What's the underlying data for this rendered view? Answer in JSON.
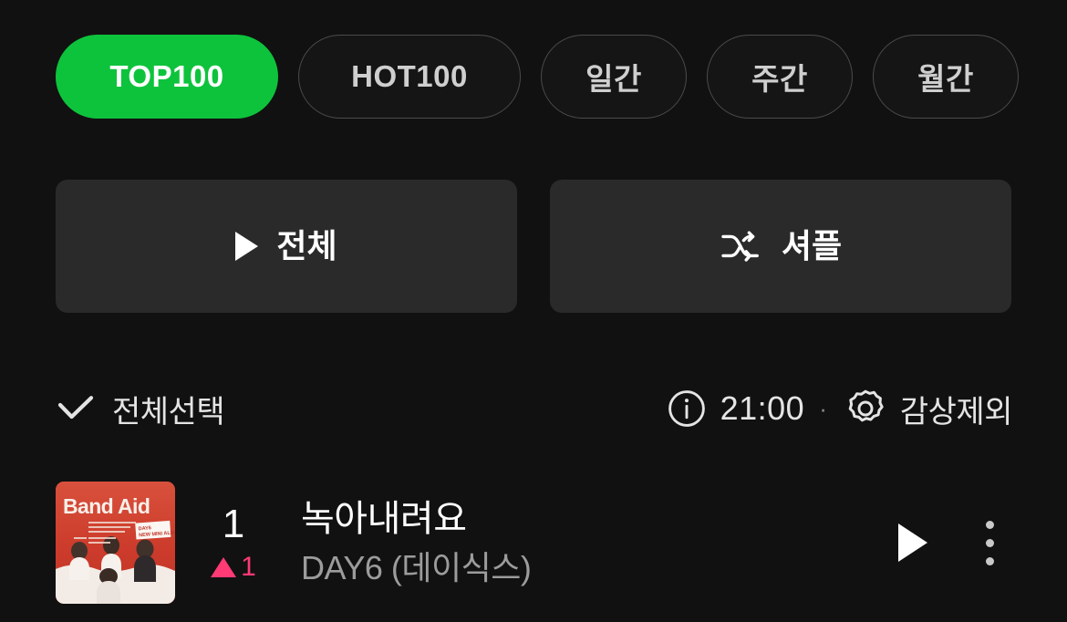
{
  "theme": {
    "background": "#111111",
    "accent_green": "#0ec33c",
    "surface": "#2a2a2a",
    "rank_up_pink": "#ff3a75",
    "text_primary": "#ffffff",
    "text_secondary": "#9c9c9c"
  },
  "filter_chips": [
    {
      "label": "TOP100",
      "active": true
    },
    {
      "label": "HOT100",
      "active": false
    },
    {
      "label": "일간",
      "active": false
    },
    {
      "label": "주간",
      "active": false
    },
    {
      "label": "월간",
      "active": false
    }
  ],
  "actions": {
    "play_all_label": "전체",
    "play_all_icon": "play-icon",
    "shuffle_label": "셔플",
    "shuffle_icon": "shuffle-icon"
  },
  "meta_bar": {
    "select_all_label": "전체선택",
    "select_all_icon": "check-icon",
    "info_icon": "info-circle-icon",
    "chart_time": "21:00",
    "separator": "·",
    "settings_icon": "gear-icon",
    "exclude_label": "감상제외"
  },
  "tracks": [
    {
      "rank": "1",
      "rank_change_direction": "up",
      "rank_change_value": "1",
      "title": "녹아내려요",
      "artist": "DAY6 (데이식스)",
      "album_art": {
        "title_text": "Band Aid",
        "sticker_line1": "DAY6",
        "sticker_line2": "NEW MINI ALBUM",
        "background_color": "#d2402f"
      },
      "play_icon": "play-icon",
      "more_icon": "more-vertical-icon"
    }
  ]
}
